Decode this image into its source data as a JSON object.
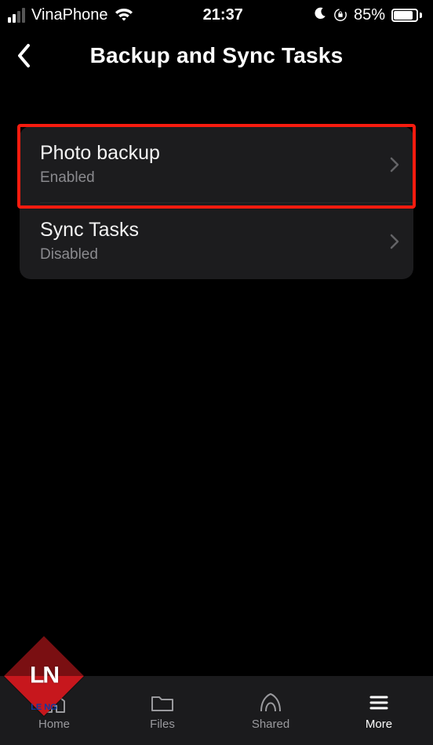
{
  "status": {
    "carrier": "VinaPhone",
    "time": "21:37",
    "battery_percent": "85%",
    "battery_fill_percent": 85
  },
  "nav": {
    "title": "Backup and Sync Tasks"
  },
  "rows": [
    {
      "title": "Photo backup",
      "subtitle": "Enabled"
    },
    {
      "title": "Sync Tasks",
      "subtitle": "Disabled"
    }
  ],
  "tabs": {
    "home": "Home",
    "files": "Files",
    "shared": "Shared",
    "more": "More"
  },
  "watermark": {
    "letters": "LN",
    "sub": "LE NG"
  }
}
